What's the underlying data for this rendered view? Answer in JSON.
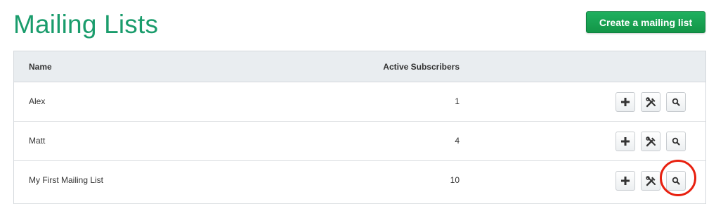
{
  "header": {
    "title": "Mailing Lists",
    "create_button_label": "Create a mailing list"
  },
  "table": {
    "columns": {
      "name": "Name",
      "active_subscribers": "Active Subscribers"
    },
    "rows": [
      {
        "name": "Alex",
        "active_subscribers": "1"
      },
      {
        "name": "Matt",
        "active_subscribers": "4"
      },
      {
        "name": "My First Mailing List",
        "active_subscribers": "10"
      }
    ],
    "row_actions": [
      "plus-icon",
      "tools-icon",
      "search-icon"
    ]
  },
  "colors": {
    "title": "#1a9c6c",
    "primary_button": "#139547",
    "highlight_ring": "#e8200f"
  }
}
